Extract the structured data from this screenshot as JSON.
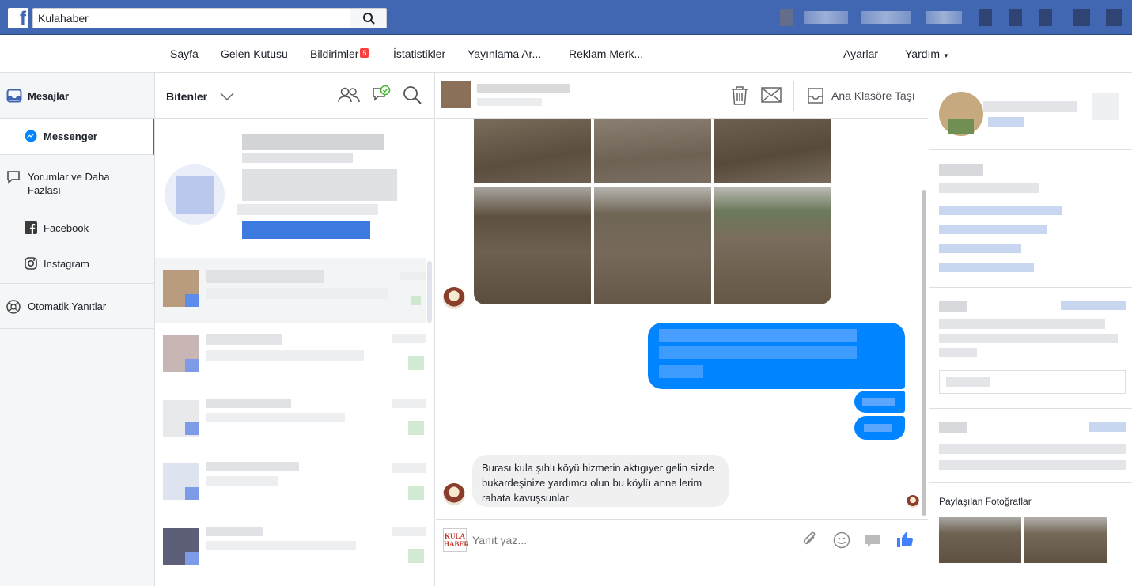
{
  "search": {
    "value": "Kulahaber"
  },
  "subnav": {
    "items": [
      "Sayfa",
      "Gelen Kutusu",
      "Bildirimler",
      "İstatistikler",
      "Yayınlama Ar...",
      "Reklam Merk..."
    ],
    "notifications_badge": "5",
    "settings": "Ayarlar",
    "help": "Yardım"
  },
  "sidebar": {
    "messages": "Mesajlar",
    "messenger": "Messenger",
    "comments": "Yorumlar ve Daha Fazlası",
    "facebook": "Facebook",
    "instagram": "Instagram",
    "auto_replies": "Otomatik Yanıtlar"
  },
  "conversation_list": {
    "filter_label": "Bitenler"
  },
  "chat": {
    "move_to_inbox": "Ana Klasöre Taşı",
    "incoming_message": "Burası kula şıhlı köyü hizmetin aktıgıyer gelin sizde bukardeşinize yardımcı olun bu köylü anne lerim rahata kavuşsunlar",
    "reply_placeholder": "Yanıt yaz...",
    "logo_text": "KULA HABER"
  },
  "right_panel": {
    "shared_photos": "Paylaşılan Fotoğraflar"
  },
  "colors": {
    "brand_blue": "#4267b2",
    "messenger_blue": "#0084ff",
    "badge_red": "#fa3e3e"
  }
}
